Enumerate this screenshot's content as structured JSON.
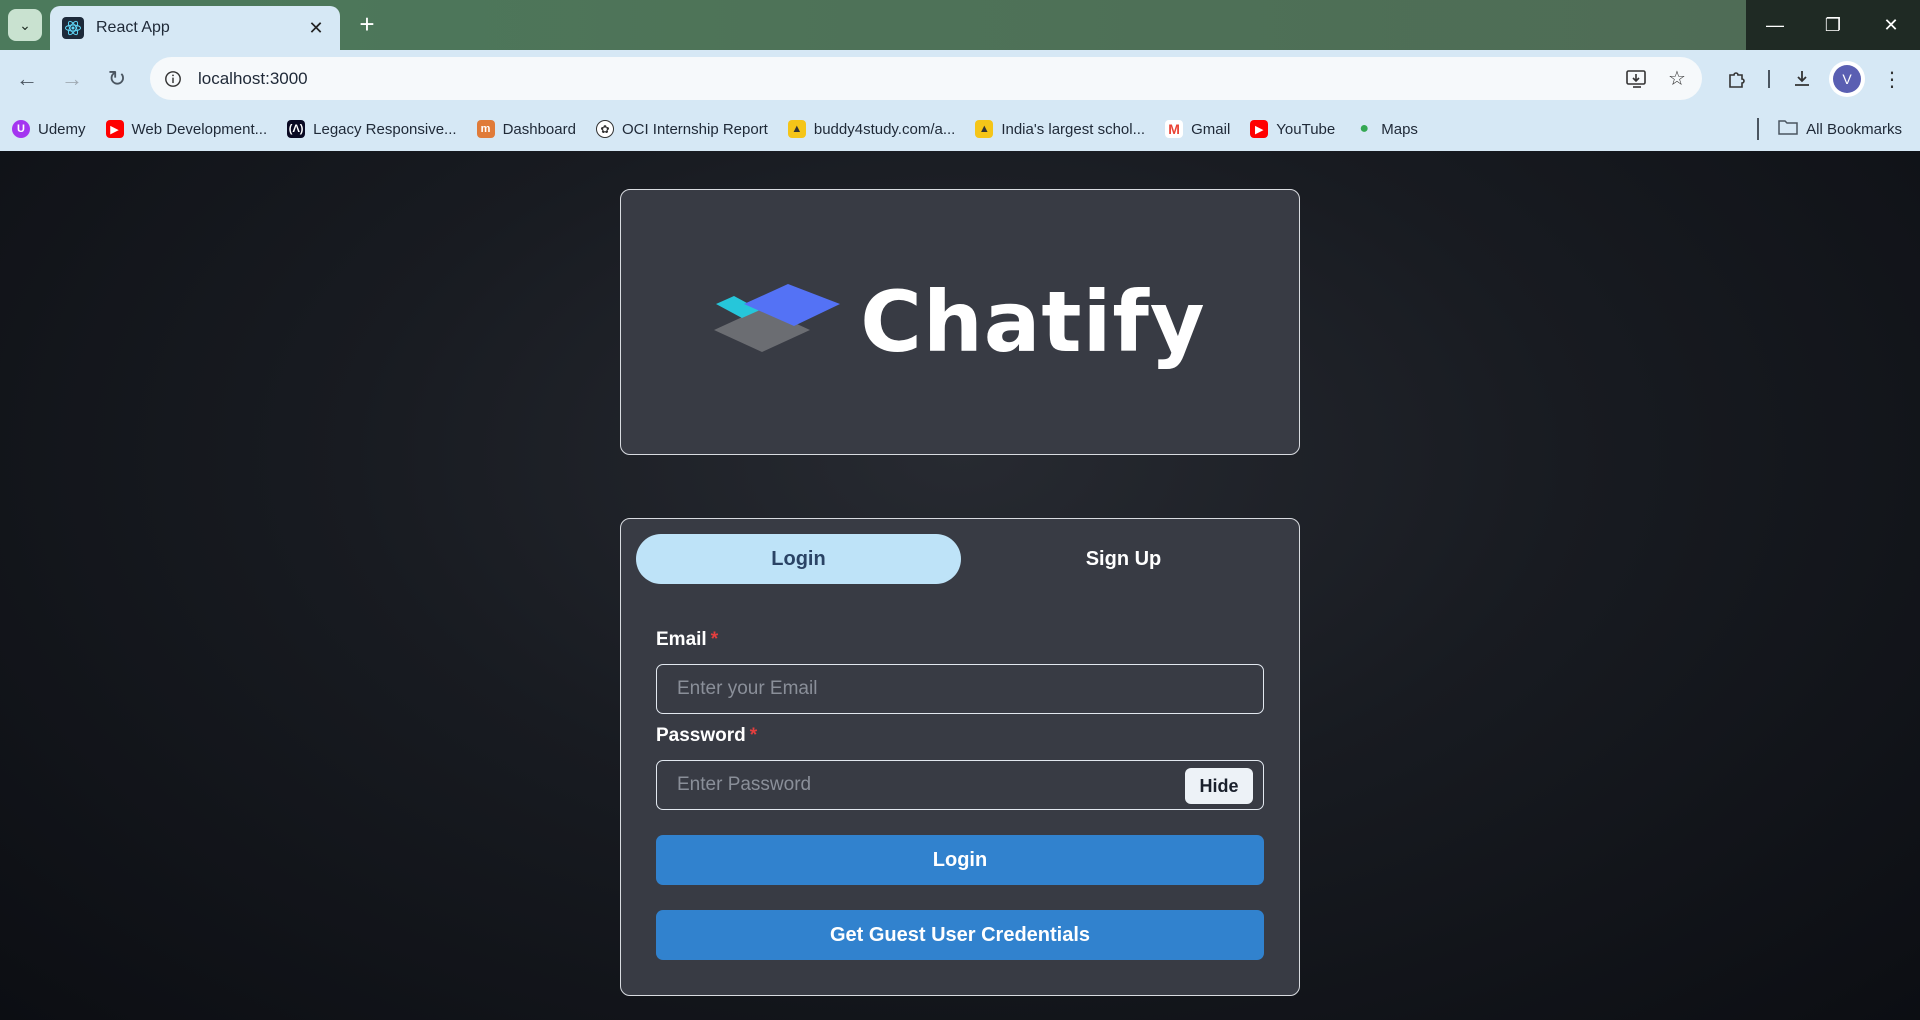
{
  "browser": {
    "tab_title": "React App",
    "url": "localhost:3000",
    "bookmarks": [
      {
        "label": "Udemy",
        "icon": "udemy-icon",
        "color": "#a435f0"
      },
      {
        "label": "Web Development...",
        "icon": "youtube-icon",
        "color": "#ff0000"
      },
      {
        "label": "Legacy Responsive...",
        "icon": "freecodecamp-icon",
        "color": "#0a0a23"
      },
      {
        "label": "Dashboard",
        "icon": "dashboard-icon",
        "color": "#e07b39"
      },
      {
        "label": "OCI Internship Report",
        "icon": "openai-icon",
        "color": "#333333"
      },
      {
        "label": "buddy4study.com/a...",
        "icon": "scholar-icon",
        "color": "#f5c518"
      },
      {
        "label": "India's largest schol...",
        "icon": "scholar-icon",
        "color": "#f5c518"
      },
      {
        "label": "Gmail",
        "icon": "gmail-icon",
        "color": "#ea4335"
      },
      {
        "label": "YouTube",
        "icon": "youtube-icon",
        "color": "#ff0000"
      },
      {
        "label": "Maps",
        "icon": "maps-icon",
        "color": "#34a853"
      }
    ],
    "all_bookmarks": "All Bookmarks",
    "profile_initial": "V"
  },
  "app": {
    "brand": "Chatify",
    "tabs": {
      "login": "Login",
      "signup": "Sign Up"
    },
    "email": {
      "label": "Email",
      "required": "*",
      "placeholder": "Enter your Email"
    },
    "password": {
      "label": "Password",
      "required": "*",
      "placeholder": "Enter Password",
      "toggle": "Hide"
    },
    "login_button": "Login",
    "guest_button": "Get Guest User Credentials"
  },
  "colors": {
    "accent": "#3182ce",
    "tab_active": "#bee3f8",
    "card": "#383b44",
    "required": "#e53e3e"
  }
}
